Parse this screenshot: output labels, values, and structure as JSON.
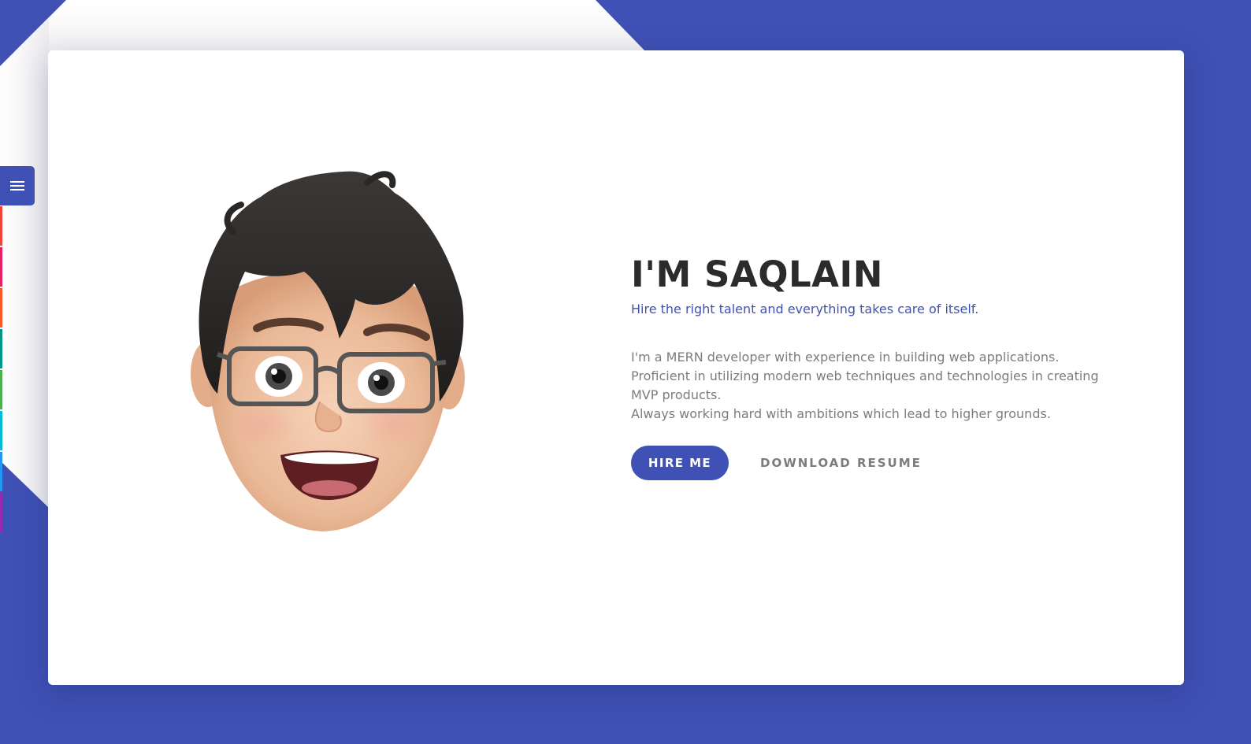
{
  "colors": {
    "accent": "#3f51b5",
    "background": "#3f51b5",
    "card": "#ffffff",
    "heading": "#2b2b2b",
    "body_text": "#7c7c7c"
  },
  "sidebar": {
    "menu_icon": "hamburger-menu-icon",
    "color_swatches": [
      "#f44336",
      "#e91e63",
      "#ff5722",
      "#009688",
      "#4caf50",
      "#00bcd4",
      "#2196f3",
      "#9c27b0",
      "#3f51b5"
    ]
  },
  "hero": {
    "avatar_icon": "memoji-avatar",
    "title": "I'M SAQLAIN",
    "tagline": "Hire the right talent and everything takes care of itself.",
    "description": [
      "I'm a MERN developer with experience in building web applications.",
      "Proficient in utilizing modern web techniques and technologies in creating MVP products.",
      "Always working hard with ambitions which lead to higher grounds."
    ],
    "hire_label": "HIRE ME",
    "resume_label": "DOWNLOAD RESUME"
  }
}
